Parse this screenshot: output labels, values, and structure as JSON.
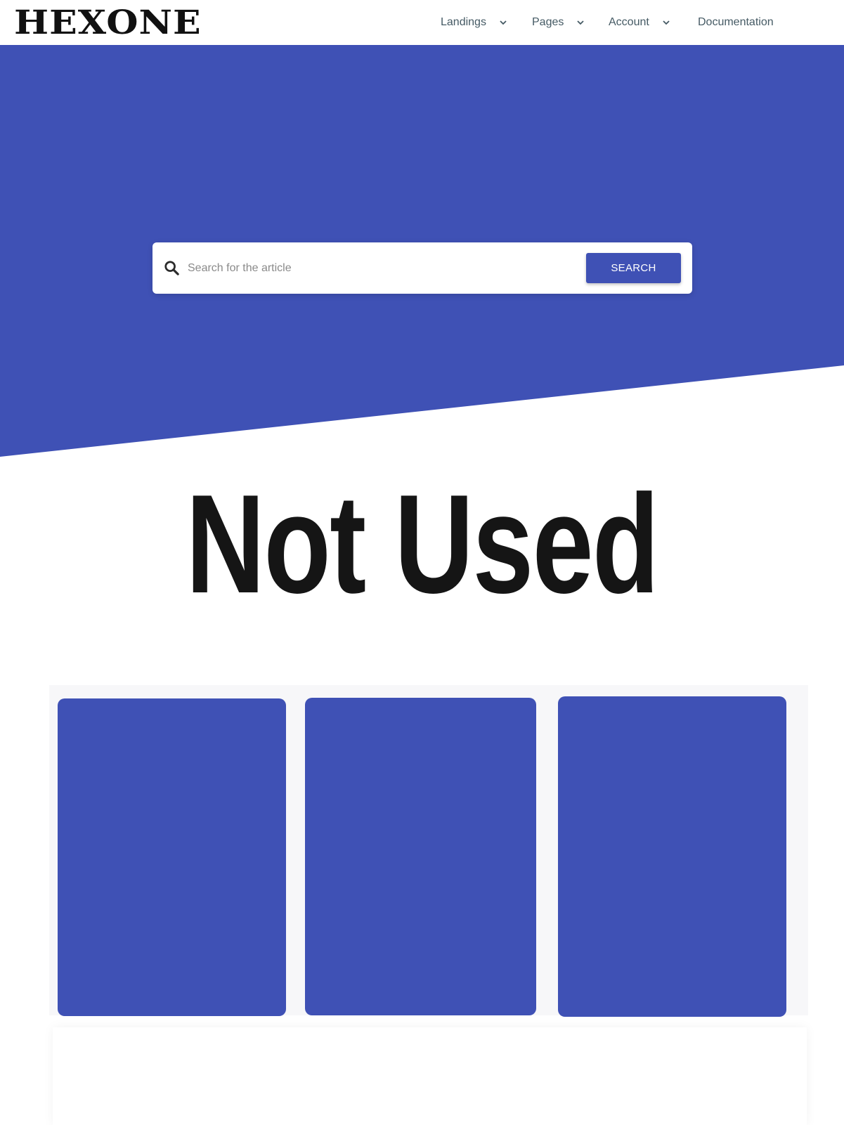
{
  "brand": {
    "logo_text": "HEXONE"
  },
  "nav": {
    "items": [
      {
        "label": "Landings",
        "has_dropdown": true
      },
      {
        "label": "Pages",
        "has_dropdown": true
      },
      {
        "label": "Account",
        "has_dropdown": true
      },
      {
        "label": "Documentation",
        "has_dropdown": false
      }
    ]
  },
  "search": {
    "placeholder": "Search for the article",
    "value": "",
    "button_label": "SEARCH",
    "icon": "search-icon"
  },
  "main": {
    "title": "Not Used"
  },
  "colors": {
    "accent": "#3f51b5",
    "nav_text": "#455a64",
    "title_text": "#151515",
    "background": "#ffffff"
  },
  "cards": [
    {
      "color": "#3f51b5"
    },
    {
      "color": "#3f51b5"
    },
    {
      "color": "#3f51b5"
    }
  ]
}
